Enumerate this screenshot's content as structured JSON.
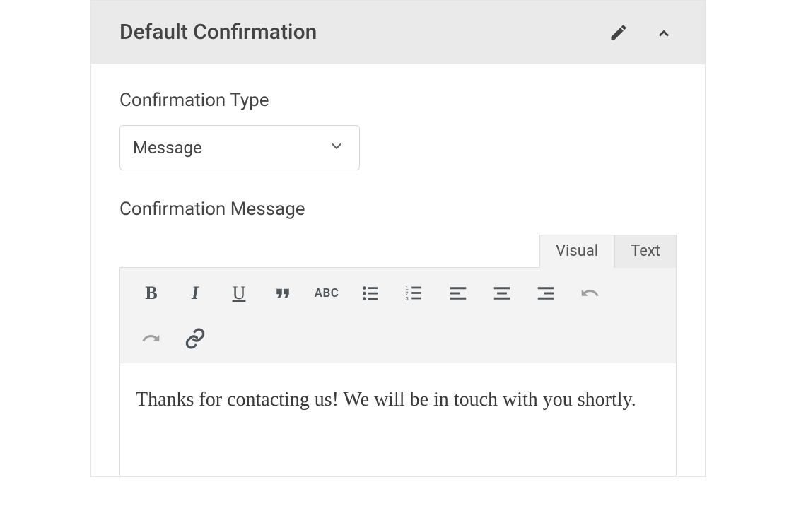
{
  "header": {
    "title": "Default Confirmation"
  },
  "fields": {
    "type_label": "Confirmation Type",
    "type_value": "Message",
    "message_label": "Confirmation Message"
  },
  "editor": {
    "tabs": {
      "visual": "Visual",
      "text": "Text"
    },
    "content": "Thanks for contacting us! We will be in touch with you shortly.",
    "tools": {
      "bold": "B",
      "italic": "I",
      "underline": "U",
      "strike": "ABC"
    }
  }
}
